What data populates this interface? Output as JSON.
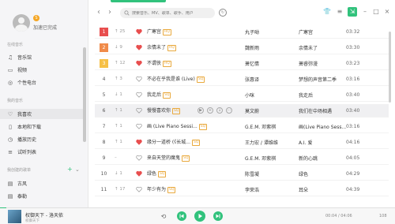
{
  "profile": {
    "username": "加速已完成",
    "vip_badge": "S"
  },
  "sidebar": {
    "online_music_title": "在线音乐",
    "online_items": [
      {
        "label": "音乐馆",
        "icon": "music-hall-icon"
      },
      {
        "label": "视频",
        "icon": "video-icon"
      },
      {
        "label": "个性电台",
        "icon": "radio-icon"
      }
    ],
    "my_music_title": "我的音乐",
    "my_items": [
      {
        "label": "我喜欢",
        "icon": "heart-icon"
      },
      {
        "label": "本地和下载",
        "icon": "download-icon"
      },
      {
        "label": "播放历史",
        "icon": "history-icon"
      },
      {
        "label": "试听列表",
        "icon": "list-icon"
      }
    ],
    "created_title": "我创建的歌单",
    "created_items": [
      {
        "label": "古风",
        "icon": "playlist-icon"
      },
      {
        "label": "泰勒",
        "icon": "playlist-icon"
      }
    ]
  },
  "topbar": {
    "search_placeholder": "搜索音乐、MV、歌单、歌手、用户"
  },
  "colors": {
    "accent": "#31c27c",
    "rank1": "#e84e4e",
    "rank2": "#f08b4a",
    "rank3": "#f6c046",
    "heart": "#e84e4e"
  },
  "rows": [
    {
      "rank": "1",
      "trend": "↑ 25",
      "song": "广寒宫",
      "badge": "HQ",
      "singer": "丸子呦",
      "album": "广寒宫",
      "duration": "03:32",
      "liked": true
    },
    {
      "rank": "2",
      "trend": "↓ 9",
      "song": "余情未了",
      "badge": "HQ",
      "singer": "魏新雨",
      "album": "余情未了",
      "duration": "03:30",
      "liked": true
    },
    {
      "rank": "3",
      "trend": "↑ 12",
      "song": "不谓侠",
      "badge": "HQ",
      "singer": "萧忆情",
      "album": "萧睿弥漫",
      "duration": "03:23",
      "liked": true
    },
    {
      "rank": "4",
      "trend": "↑ 3",
      "song": "不必在乎我是谁 (Live)",
      "badge": "SQ",
      "singer": "张惠译",
      "album": "梦想的声音第二季",
      "duration": "03:16",
      "liked": false
    },
    {
      "rank": "5",
      "trend": "↓ 1",
      "song": "我走后",
      "badge": "SQ",
      "singer": "小咪",
      "album": "我走后",
      "duration": "03:40",
      "liked": false
    },
    {
      "rank": "6",
      "trend": "↑ 1",
      "song": "慢慢喜欢你",
      "badge": "SQ",
      "singer": "莫文蔚",
      "album": "我们在中场相遇",
      "duration": "03:40",
      "liked": false
    },
    {
      "rank": "7",
      "trend": "↑ 1",
      "song": "画 (Live Piano Sessi...",
      "badge": "SQ",
      "singer": "G.E.M. 邓紫棋",
      "album": "画(Live Piano Sess...",
      "duration": "03:16",
      "liked": false
    },
    {
      "rank": "8",
      "trend": "↑ 1",
      "song": "缘分一道桥 (《长城...",
      "badge": "SQ",
      "singer": "王力宏 / 谭维维",
      "album": "A.I. 爱",
      "duration": "04:16",
      "liked": true
    },
    {
      "rank": "9",
      "trend": "–",
      "song": "来自天堂的魔鬼",
      "badge": "SQ",
      "singer": "G.E.M. 邓紫棋",
      "album": "新的心跳",
      "duration": "04:05",
      "liked": false
    },
    {
      "rank": "10",
      "trend": "↓ 1",
      "song": "绿色",
      "badge": "SQ",
      "singer": "陈雪凝",
      "album": "绿色",
      "duration": "04:29",
      "liked": true
    },
    {
      "rank": "11",
      "trend": "↑ 17",
      "song": "年少有为",
      "badge": "SQ",
      "singer": "李荣浩",
      "album": "耳朵",
      "duration": "04:39",
      "liked": false
    }
  ],
  "player": {
    "title": "权御天下 - 洛天依",
    "subtitle": "权御天下",
    "time": "00:04 / 04:06",
    "volume_count": "108",
    "progress": 0.016
  }
}
